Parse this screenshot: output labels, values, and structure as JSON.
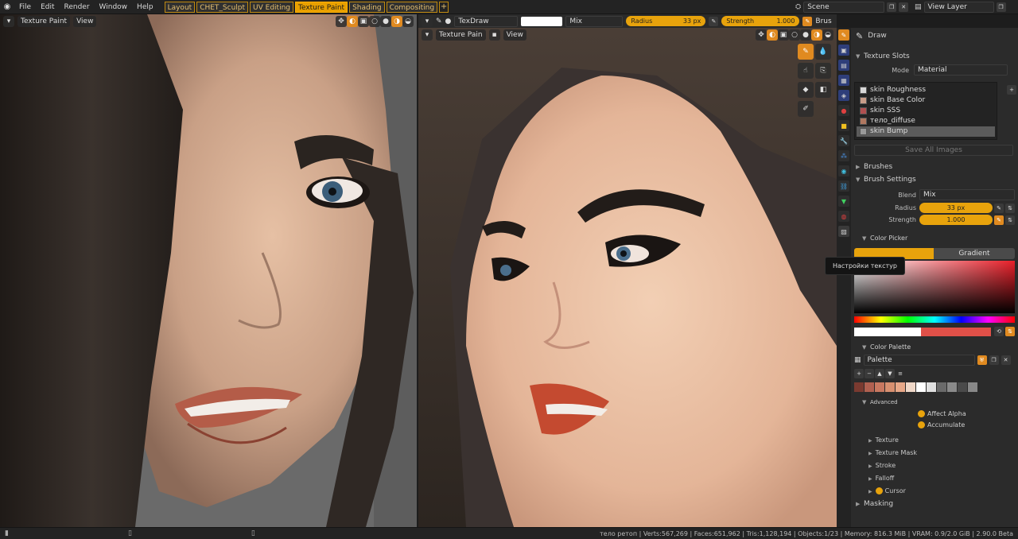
{
  "menu": [
    "File",
    "Edit",
    "Render",
    "Window",
    "Help"
  ],
  "workspaces": [
    {
      "label": "Layout",
      "active": false
    },
    {
      "label": "CHET_Sculpt",
      "active": false
    },
    {
      "label": "UV Editing",
      "active": false
    },
    {
      "label": "Texture Paint",
      "active": true
    },
    {
      "label": "Shading",
      "active": false
    },
    {
      "label": "Compositing",
      "active": false
    }
  ],
  "workspace_add": "+",
  "scene_name": "Scene",
  "view_layer": "View Layer",
  "left_viewport": {
    "mode": "Texture Paint",
    "view": "View"
  },
  "tool_header": {
    "brush_name": "TexDraw",
    "blend": "Mix",
    "radius_label": "Radius",
    "radius_value": "33 px",
    "strength_label": "Strength",
    "strength_value": "1.000",
    "brush_cut": "Brus"
  },
  "right_viewport": {
    "mode": "Texture Pain",
    "view": "View"
  },
  "props": {
    "tool_name": "Draw",
    "texture_slots_title": "Texture Slots",
    "mode_label": "Mode",
    "mode_value": "Material",
    "slots": [
      {
        "name": "skin Roughness",
        "color": "#d8d8d8",
        "selected": false
      },
      {
        "name": "skin Base Color",
        "color": "#c89c88",
        "selected": false
      },
      {
        "name": "skin SSS",
        "color": "#b05050",
        "selected": false
      },
      {
        "name": "тело_diffuse",
        "color": "#b07860",
        "selected": false
      },
      {
        "name": "skin Bump",
        "color": "#9a9a9a",
        "selected": true
      }
    ],
    "save_all": "Save All Images",
    "brushes": "Brushes",
    "brush_settings": "Brush Settings",
    "blend_label": "Blend",
    "blend_value": "Mix",
    "radius_label": "Radius",
    "radius_value": "33 px",
    "strength_label": "Strength",
    "strength_value": "1.000",
    "color_picker": "Color Picker",
    "gradient_tab": "Gradient",
    "color_palette": "Color Palette",
    "palette_name": "Palette",
    "palette_colors": [
      "#7a3a30",
      "#b06050",
      "#c87860",
      "#d89070",
      "#e8a888",
      "#f0d8c8",
      "#ffffff",
      "#e0e0e0",
      "#6a6a6a",
      "#8a8a8a",
      "#4a4a4a",
      "#888888"
    ],
    "advanced": "Advanced",
    "affect_alpha": "Affect Alpha",
    "accumulate": "Accumulate",
    "texture": "Texture",
    "texture_mask": "Texture Mask",
    "stroke": "Stroke",
    "falloff": "Falloff",
    "cursor": "Cursor",
    "masking": "Masking"
  },
  "tooltip": "Настройки текстур",
  "status": "тело ретоп | Verts:567,269 | Faces:651,962 | Tris:1,128,194 | Objects:1/23 | Memory: 816.3 MiB | VRAM: 0.9/2.0 GiB | 2.90.0 Beta",
  "colors": {
    "accent": "#e8a30c",
    "primary_color": "#ffffff",
    "secondary_color": "#e05048"
  }
}
